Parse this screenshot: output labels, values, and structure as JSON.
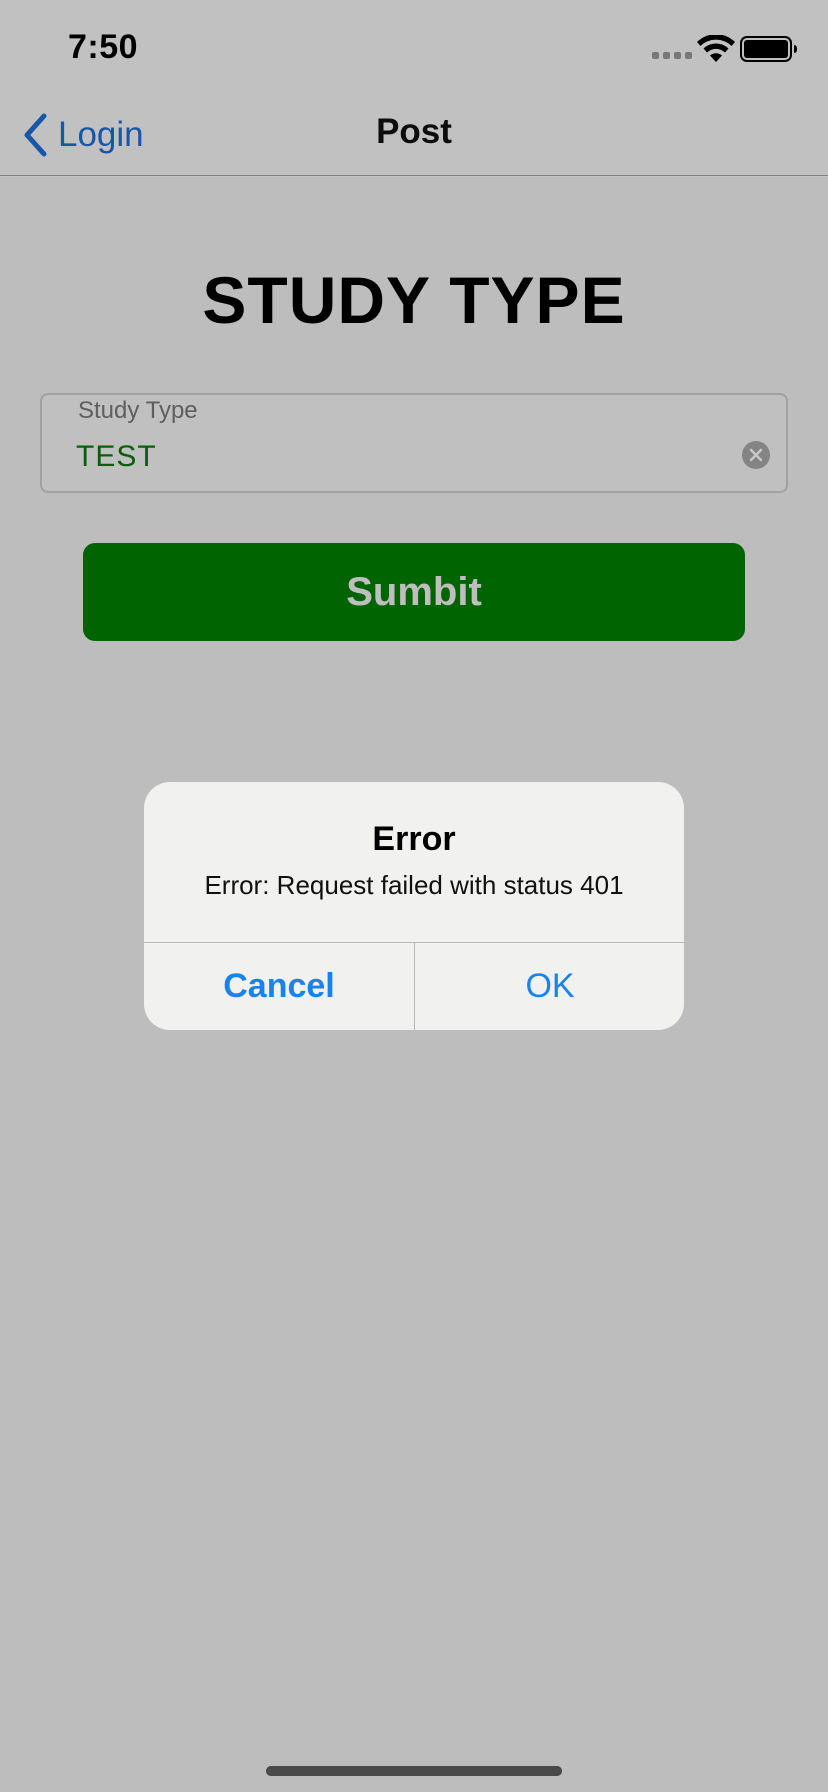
{
  "status_bar": {
    "time": "7:50",
    "icons": [
      "cellular-signal-icon",
      "wifi-icon",
      "battery-icon"
    ]
  },
  "nav": {
    "back_label": "Login",
    "title": "Post"
  },
  "main": {
    "heading": "STUDY TYPE",
    "field": {
      "label": "Study Type",
      "value": "TEST"
    },
    "submit_label": "Sumbit"
  },
  "alert": {
    "title": "Error",
    "message": "Error: Request failed with status 401",
    "cancel_label": "Cancel",
    "ok_label": "OK"
  },
  "colors": {
    "accent_blue": "#1a82ec",
    "submit_green": "#008000",
    "input_text_green": "#0a7a0a"
  }
}
